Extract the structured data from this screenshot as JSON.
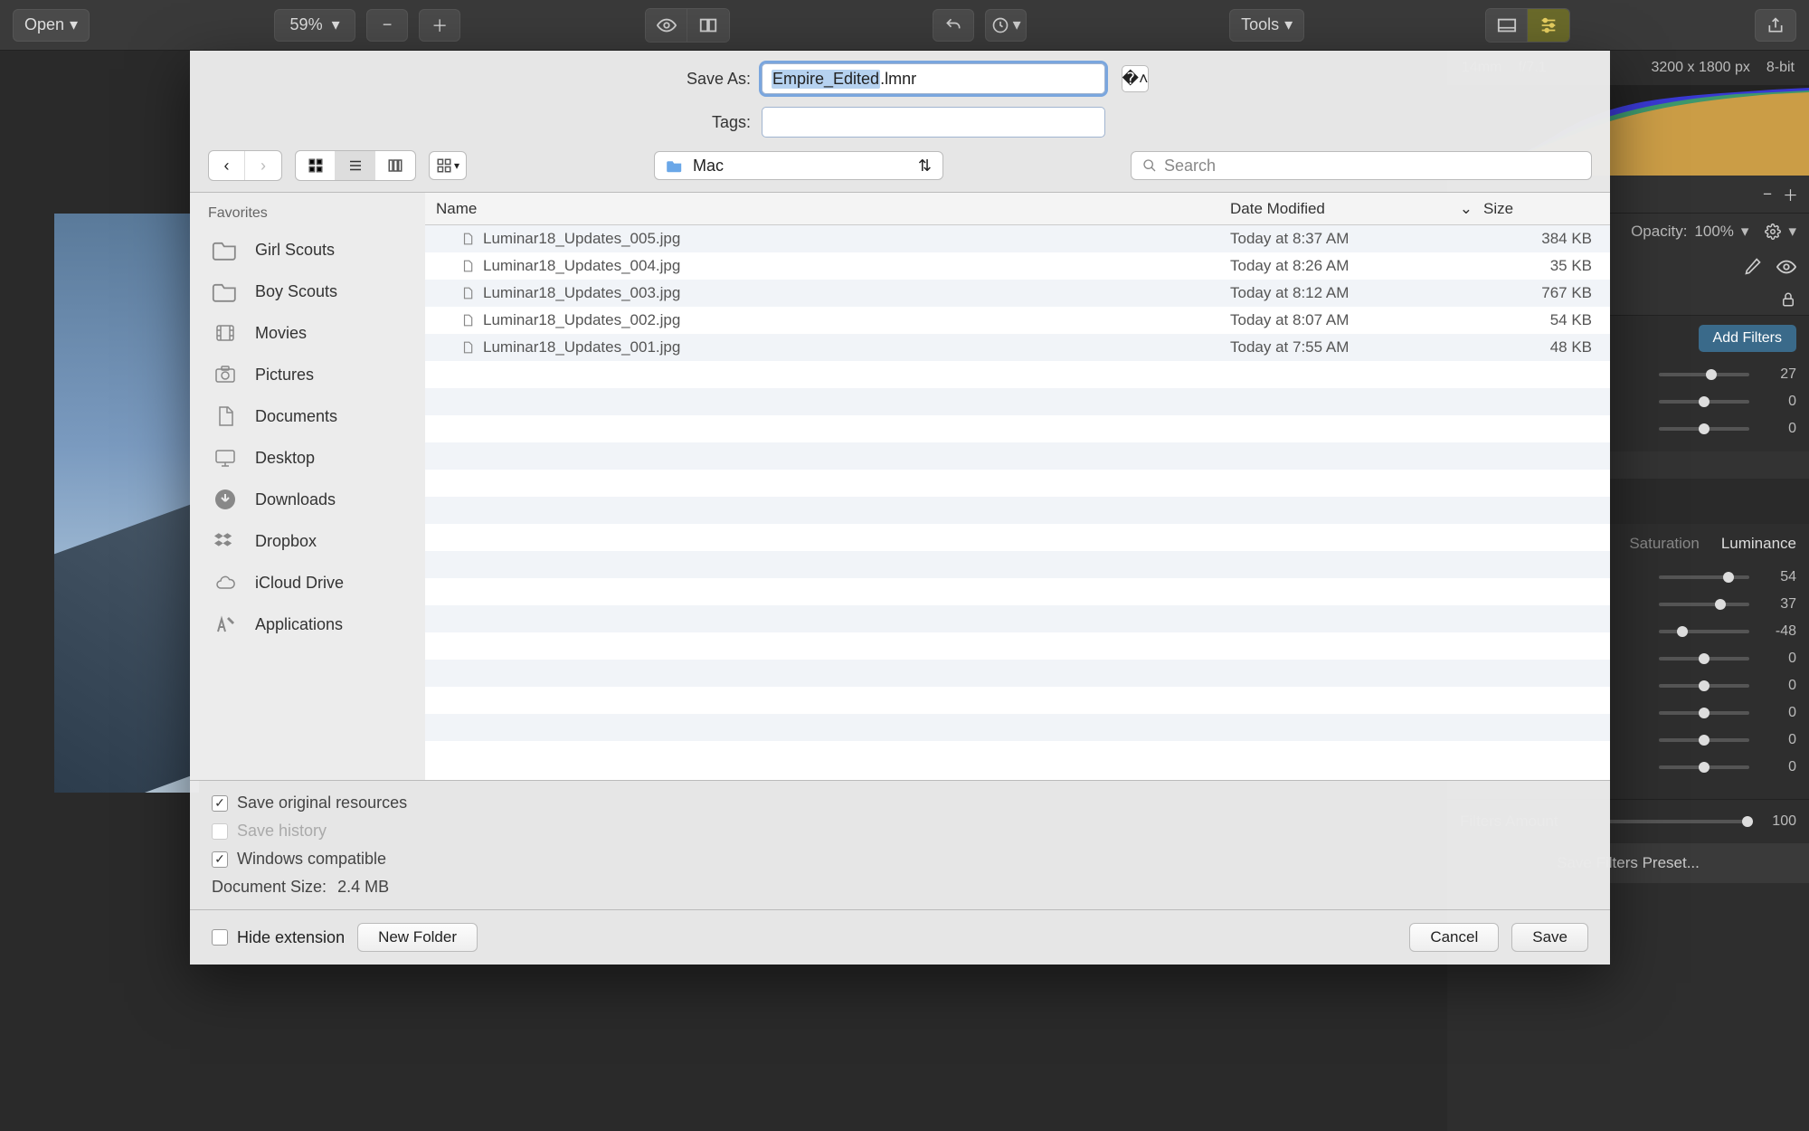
{
  "toolbar": {
    "open_label": "Open",
    "zoom_value": "59%",
    "tools_label": "Tools"
  },
  "image_meta": {
    "focal": "14mm",
    "aperture": "f/7.1",
    "dimensions": "3200 x 1800 px",
    "bit_depth": "8-bit"
  },
  "right_panel": {
    "opacity_label": "Opacity:",
    "opacity_value": "100%",
    "add_filters_label": "Add Filters",
    "tabs": {
      "saturation": "Saturation",
      "luminance": "Luminance"
    },
    "group1": [
      {
        "value": "27",
        "pos": 58
      },
      {
        "value": "0",
        "pos": 50
      },
      {
        "value": "0",
        "pos": 50
      }
    ],
    "group2": [
      {
        "value": "54",
        "pos": 77
      },
      {
        "value": "37",
        "pos": 68
      },
      {
        "value": "-48",
        "pos": 26
      },
      {
        "value": "0",
        "pos": 50
      },
      {
        "value": "0",
        "pos": 50
      },
      {
        "value": "0",
        "pos": 50
      },
      {
        "value": "0",
        "pos": 50
      },
      {
        "value": "0",
        "pos": 50
      }
    ],
    "filters_amount_label": "Filters Amount",
    "filters_amount_value": "100",
    "save_preset_label": "Save Filters Preset..."
  },
  "dialog": {
    "save_as_label": "Save As:",
    "filename_base": "Empire_Edited",
    "filename_ext": ".lmnr",
    "tags_label": "Tags:",
    "tags_value": "",
    "location": "Mac",
    "search_placeholder": "Search",
    "favorites_header": "Favorites",
    "favorites": [
      {
        "icon": "folder-icon",
        "label": "Girl Scouts"
      },
      {
        "icon": "folder-icon",
        "label": "Boy Scouts"
      },
      {
        "icon": "movies-icon",
        "label": "Movies"
      },
      {
        "icon": "pictures-icon",
        "label": "Pictures"
      },
      {
        "icon": "documents-icon",
        "label": "Documents"
      },
      {
        "icon": "desktop-icon",
        "label": "Desktop"
      },
      {
        "icon": "downloads-icon",
        "label": "Downloads"
      },
      {
        "icon": "dropbox-icon",
        "label": "Dropbox"
      },
      {
        "icon": "icloud-icon",
        "label": "iCloud Drive"
      },
      {
        "icon": "applications-icon",
        "label": "Applications"
      }
    ],
    "columns": {
      "name": "Name",
      "date": "Date Modified",
      "size": "Size"
    },
    "files": [
      {
        "name": "Luminar18_Updates_005.jpg",
        "date": "Today at 8:37 AM",
        "size": "384 KB"
      },
      {
        "name": "Luminar18_Updates_004.jpg",
        "date": "Today at 8:26 AM",
        "size": "35 KB"
      },
      {
        "name": "Luminar18_Updates_003.jpg",
        "date": "Today at 8:12 AM",
        "size": "767 KB"
      },
      {
        "name": "Luminar18_Updates_002.jpg",
        "date": "Today at 8:07 AM",
        "size": "54 KB"
      },
      {
        "name": "Luminar18_Updates_001.jpg",
        "date": "Today at 7:55 AM",
        "size": "48 KB"
      }
    ],
    "options": {
      "save_resources": "Save original resources",
      "save_history": "Save history",
      "windows_compat": "Windows compatible",
      "doc_size_label": "Document Size:",
      "doc_size_value": "2.4 MB"
    },
    "footer": {
      "hide_ext": "Hide extension",
      "new_folder": "New Folder",
      "cancel": "Cancel",
      "save": "Save"
    }
  }
}
